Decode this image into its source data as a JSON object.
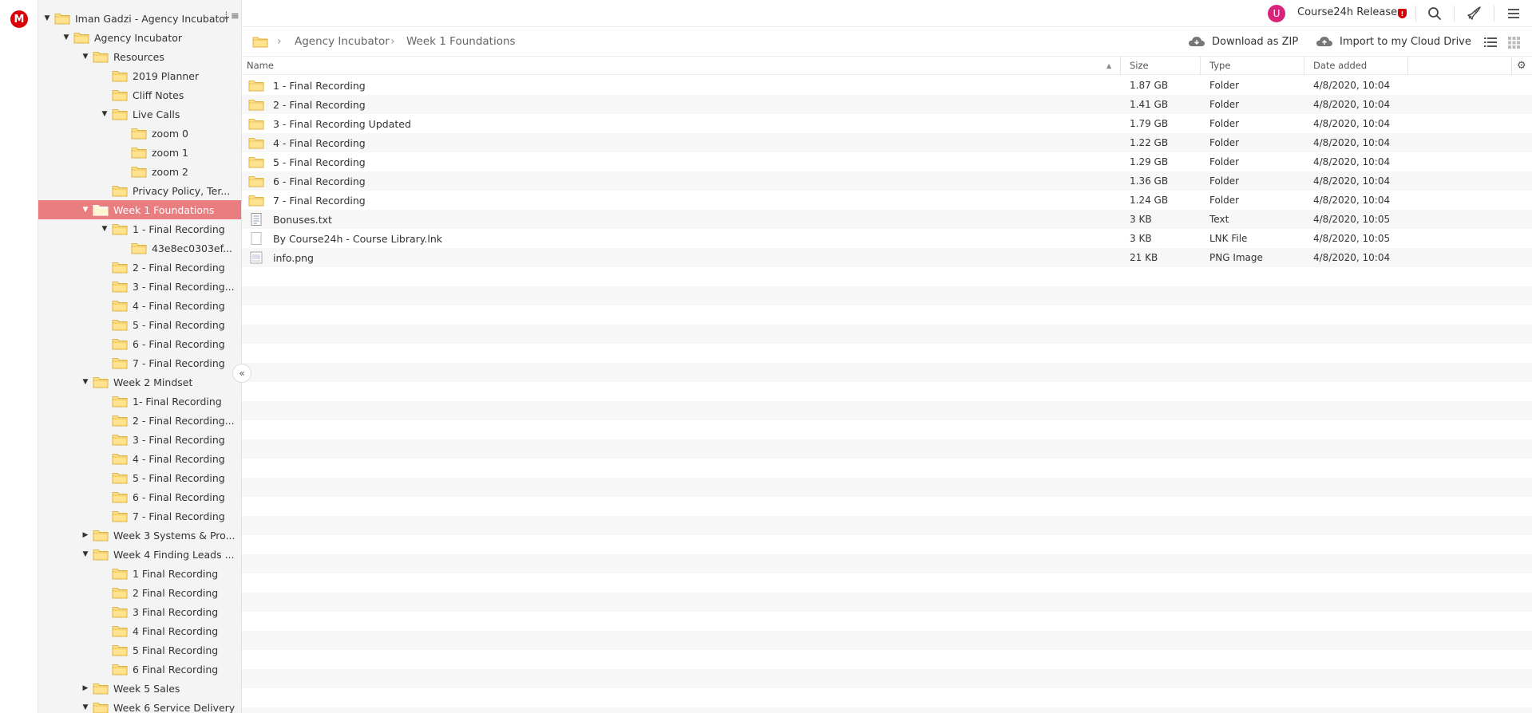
{
  "app": {
    "logo_letter": "M"
  },
  "tree": {
    "items": [
      {
        "label": "Iman Gadzi - Agency Incubator",
        "level": 0,
        "toggle": "open"
      },
      {
        "label": "Agency Incubator",
        "level": 1,
        "toggle": "open"
      },
      {
        "label": "Resources",
        "level": 2,
        "toggle": "open"
      },
      {
        "label": "2019 Planner",
        "level": 3,
        "toggle": "none"
      },
      {
        "label": "Cliff Notes",
        "level": 3,
        "toggle": "none"
      },
      {
        "label": "Live Calls",
        "level": 3,
        "toggle": "open"
      },
      {
        "label": "zoom 0",
        "level": 4,
        "toggle": "none"
      },
      {
        "label": "zoom 1",
        "level": 4,
        "toggle": "none"
      },
      {
        "label": "zoom 2",
        "level": 4,
        "toggle": "none"
      },
      {
        "label": "Privacy Policy, Ter...",
        "level": 3,
        "toggle": "none"
      },
      {
        "label": "Week 1 Foundations",
        "level": 2,
        "toggle": "open",
        "selected": true
      },
      {
        "label": "1 - Final Recording",
        "level": 3,
        "toggle": "open"
      },
      {
        "label": "43e8ec0303ef...",
        "level": 4,
        "toggle": "none"
      },
      {
        "label": "2 - Final Recording",
        "level": 3,
        "toggle": "none"
      },
      {
        "label": "3 - Final Recording...",
        "level": 3,
        "toggle": "none"
      },
      {
        "label": "4 - Final Recording",
        "level": 3,
        "toggle": "none"
      },
      {
        "label": "5 - Final Recording",
        "level": 3,
        "toggle": "none"
      },
      {
        "label": "6 - Final Recording",
        "level": 3,
        "toggle": "none"
      },
      {
        "label": "7 - Final Recording",
        "level": 3,
        "toggle": "none"
      },
      {
        "label": "Week 2 Mindset",
        "level": 2,
        "toggle": "open"
      },
      {
        "label": "1- Final Recording",
        "level": 3,
        "toggle": "none"
      },
      {
        "label": "2 - Final Recording...",
        "level": 3,
        "toggle": "none"
      },
      {
        "label": "3 - Final Recording",
        "level": 3,
        "toggle": "none"
      },
      {
        "label": "4 - Final Recording",
        "level": 3,
        "toggle": "none"
      },
      {
        "label": "5 - Final Recording",
        "level": 3,
        "toggle": "none"
      },
      {
        "label": "6 - Final Recording",
        "level": 3,
        "toggle": "none"
      },
      {
        "label": "7 - Final Recording",
        "level": 3,
        "toggle": "none"
      },
      {
        "label": "Week 3 Systems & Pro...",
        "level": 2,
        "toggle": "closed"
      },
      {
        "label": "Week 4 Finding Leads ...",
        "level": 2,
        "toggle": "open"
      },
      {
        "label": "1 Final Recording",
        "level": 3,
        "toggle": "none"
      },
      {
        "label": "2 Final Recording",
        "level": 3,
        "toggle": "none"
      },
      {
        "label": "3 Final Recording",
        "level": 3,
        "toggle": "none"
      },
      {
        "label": "4 Final Recording",
        "level": 3,
        "toggle": "none"
      },
      {
        "label": "5 Final Recording",
        "level": 3,
        "toggle": "none"
      },
      {
        "label": "6 Final Recording",
        "level": 3,
        "toggle": "none"
      },
      {
        "label": "Week 5 Sales",
        "level": 2,
        "toggle": "closed"
      },
      {
        "label": "Week 6 Service Delivery",
        "level": 2,
        "toggle": "open"
      }
    ]
  },
  "topbar": {
    "avatar_letter": "U",
    "account_name": "Course24h Releases",
    "badge": "!"
  },
  "breadcrumb": {
    "items": [
      "Agency Incubator",
      "Week 1 Foundations"
    ]
  },
  "actions": {
    "download_zip": "Download as ZIP",
    "import": "Import to my Cloud Drive"
  },
  "table": {
    "columns": [
      "Name",
      "Size",
      "Type",
      "Date added"
    ],
    "rows": [
      {
        "icon": "folder",
        "name": "1 - Final Recording",
        "size": "1.87 GB",
        "type": "Folder",
        "date": "4/8/2020, 10:04"
      },
      {
        "icon": "folder",
        "name": "2 - Final Recording",
        "size": "1.41 GB",
        "type": "Folder",
        "date": "4/8/2020, 10:04"
      },
      {
        "icon": "folder",
        "name": "3 - Final Recording Updated",
        "size": "1.79 GB",
        "type": "Folder",
        "date": "4/8/2020, 10:04"
      },
      {
        "icon": "folder",
        "name": "4 - Final Recording",
        "size": "1.22 GB",
        "type": "Folder",
        "date": "4/8/2020, 10:04"
      },
      {
        "icon": "folder",
        "name": "5 - Final Recording",
        "size": "1.29 GB",
        "type": "Folder",
        "date": "4/8/2020, 10:04"
      },
      {
        "icon": "folder",
        "name": "6 - Final Recording",
        "size": "1.36 GB",
        "type": "Folder",
        "date": "4/8/2020, 10:04"
      },
      {
        "icon": "folder",
        "name": "7 - Final Recording",
        "size": "1.24 GB",
        "type": "Folder",
        "date": "4/8/2020, 10:04"
      },
      {
        "icon": "text-file",
        "name": "Bonuses.txt",
        "size": "3 KB",
        "type": "Text",
        "date": "4/8/2020, 10:05"
      },
      {
        "icon": "generic-file",
        "name": "By Course24h - Course Library.lnk",
        "size": "3 KB",
        "type": "LNK File",
        "date": "4/8/2020, 10:05"
      },
      {
        "icon": "image-file",
        "name": "info.png",
        "size": "21 KB",
        "type": "PNG Image",
        "date": "4/8/2020, 10:04"
      }
    ]
  },
  "colors": {
    "brand": "#d90007",
    "selected_row": "#ea7d7f",
    "folder_fill": "#ffe28f",
    "folder_stroke": "#e0b340",
    "avatar": "#d6247a"
  }
}
